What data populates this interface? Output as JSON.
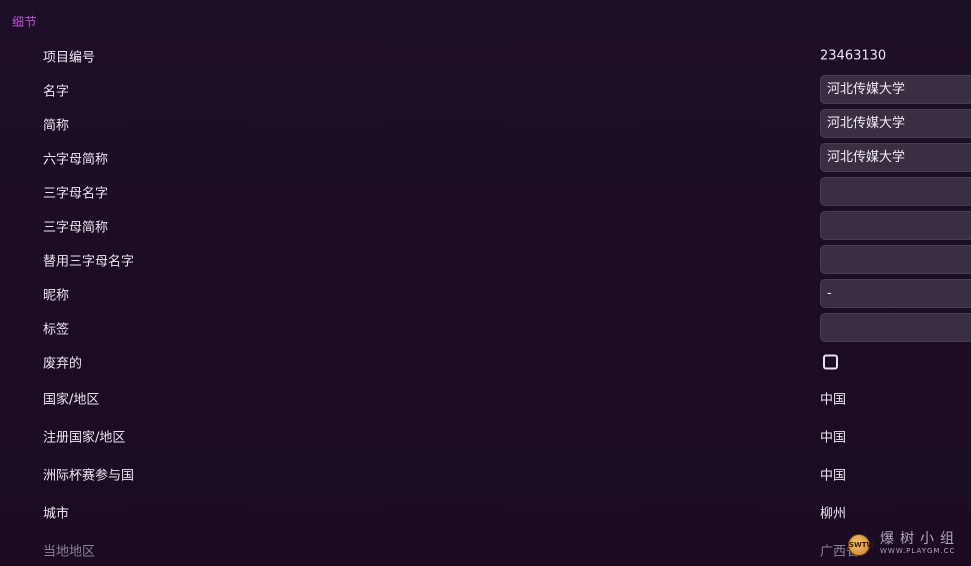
{
  "section": {
    "title": "细节"
  },
  "rows": [
    {
      "label": "项目编号",
      "value": "23463130"
    },
    {
      "label": "名字",
      "value": "河北传媒大学"
    },
    {
      "label": "简称",
      "value": "河北传媒大学"
    },
    {
      "label": "六字母简称",
      "value": "河北传媒大学"
    },
    {
      "label": "三字母名字",
      "value": ""
    },
    {
      "label": "三字母简称",
      "value": ""
    },
    {
      "label": "替用三字母名字",
      "value": ""
    },
    {
      "label": "昵称",
      "value": "-"
    },
    {
      "label": "标签",
      "value": ""
    },
    {
      "label": "废弃的",
      "checked": false
    },
    {
      "label": "国家/地区",
      "value": "中国"
    },
    {
      "label": "注册国家/地区",
      "value": "中国"
    },
    {
      "label": "洲际杯赛参与国",
      "value": "中国"
    },
    {
      "label": "城市",
      "value": "柳州"
    },
    {
      "label": "当地地区",
      "value": "广西省"
    }
  ],
  "watermark": {
    "badge": "SWTW",
    "title": "爆树小组",
    "url": "WWW.PLAYGM.CC"
  },
  "colors": {
    "background": "#1c0d25",
    "accent": "#c052d8",
    "input_bg": "#3a2e42"
  }
}
